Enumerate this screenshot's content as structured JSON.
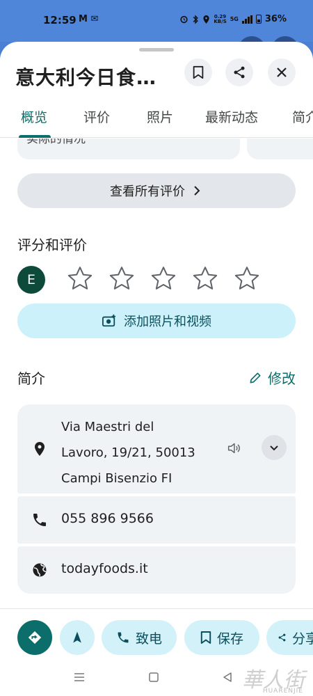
{
  "status_bar": {
    "time": "12:59",
    "left_icons": "M ✉",
    "speed_top": "0.29",
    "speed_bottom": "KB/S",
    "network": "5G",
    "battery": "36%"
  },
  "place": {
    "title": "意大利今日食…"
  },
  "tabs": [
    {
      "label": "概览"
    },
    {
      "label": "评价"
    },
    {
      "label": "照片"
    },
    {
      "label": "最新动态"
    },
    {
      "label": "简介"
    }
  ],
  "reviews": {
    "cut_text": "实际的情况",
    "see_all_label": "查看所有评价",
    "rate_title": "评分和评价",
    "user_initial": "E",
    "add_photos_label": "添加照片和视频"
  },
  "about": {
    "title": "简介",
    "edit_label": "修改",
    "address_lines": [
      "Via Maestri del",
      "Lavoro, 19/21, 50013",
      "Campi Bisenzio FI"
    ],
    "phone": "055 896 9566",
    "website": "todayfoods.it"
  },
  "actions": {
    "call_label": "致电",
    "save_label": "保存",
    "share_label": "分享"
  },
  "watermark": {
    "text": "華人街",
    "sub": "HUARENJIE"
  },
  "colors": {
    "accent": "#0b6e6b",
    "chip_bg": "#d3f1f8",
    "card_bg": "#f0f3f6"
  }
}
